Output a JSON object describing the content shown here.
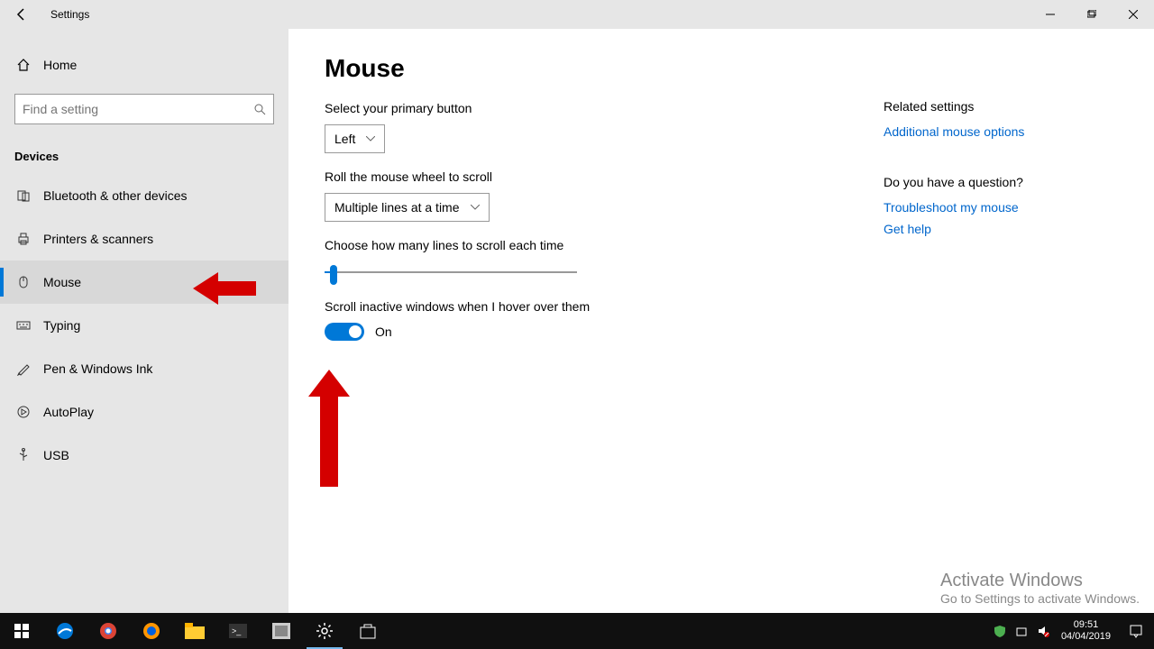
{
  "titlebar": {
    "title": "Settings"
  },
  "sidebar": {
    "home": "Home",
    "search_placeholder": "Find a setting",
    "section": "Devices",
    "items": [
      {
        "label": "Bluetooth & other devices"
      },
      {
        "label": "Printers & scanners"
      },
      {
        "label": "Mouse"
      },
      {
        "label": "Typing"
      },
      {
        "label": "Pen & Windows Ink"
      },
      {
        "label": "AutoPlay"
      },
      {
        "label": "USB"
      }
    ]
  },
  "page": {
    "title": "Mouse",
    "primary_label": "Select your primary button",
    "primary_value": "Left",
    "roll_label": "Roll the mouse wheel to scroll",
    "roll_value": "Multiple lines at a time",
    "lines_label": "Choose how many lines to scroll each time",
    "inactive_label": "Scroll inactive windows when I hover over them",
    "toggle_state": "On"
  },
  "related": {
    "header": "Related settings",
    "link1": "Additional mouse options",
    "question": "Do you have a question?",
    "link2": "Troubleshoot my mouse",
    "link3": "Get help"
  },
  "activate": {
    "title": "Activate Windows",
    "sub": "Go to Settings to activate Windows."
  },
  "taskbar": {
    "time": "09:51",
    "date": "04/04/2019"
  }
}
